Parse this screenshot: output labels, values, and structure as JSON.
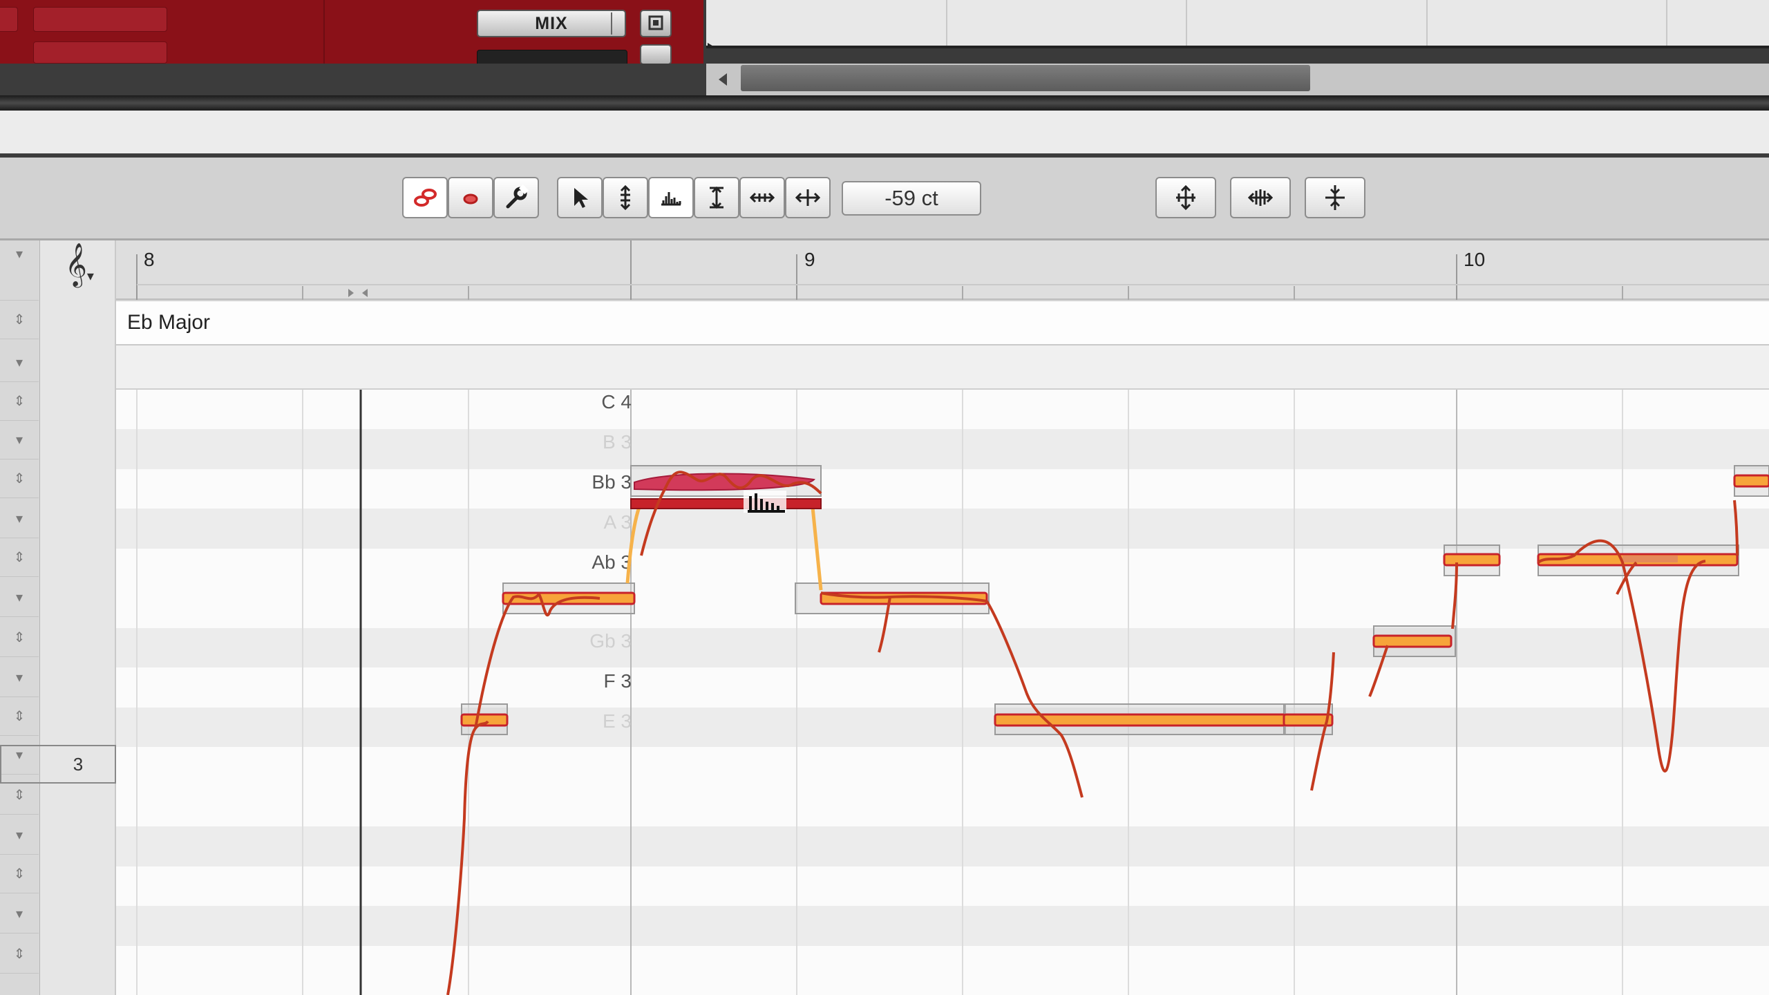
{
  "daw": {
    "mix_label": "MIX"
  },
  "toolbar": {
    "cent_value": "-59 ct",
    "tools": [
      {
        "name": "blob-tool-icon"
      },
      {
        "name": "note-blob-icon"
      },
      {
        "name": "wrench-icon"
      },
      {
        "name": "main-pointer-icon"
      },
      {
        "name": "pitch-tool-icon"
      },
      {
        "name": "amplitude-tool-icon"
      },
      {
        "name": "formant-tool-icon"
      },
      {
        "name": "time-tool-icon"
      },
      {
        "name": "move-tool-icon"
      }
    ]
  },
  "ruler": {
    "bars": [
      "8",
      "9",
      "10"
    ]
  },
  "key": {
    "label": "Eb Major"
  },
  "lane": {
    "number": "3"
  },
  "pitch_labels": [
    {
      "text": "C 4",
      "in_key": true
    },
    {
      "text": "B 3",
      "in_key": false
    },
    {
      "text": "Bb 3",
      "in_key": true
    },
    {
      "text": "A 3",
      "in_key": false
    },
    {
      "text": "Ab 3",
      "in_key": true
    },
    {
      "text": "Gb 3",
      "in_key": false
    },
    {
      "text": "F 3",
      "in_key": true
    },
    {
      "text": "E 3",
      "in_key": false
    }
  ],
  "colors": {
    "note_orange": "#f5a623",
    "note_red": "#c7222a",
    "pitch_curve": "#c43a1f",
    "selected_blob": "#d23a5a",
    "track_red": "#8a1118"
  }
}
